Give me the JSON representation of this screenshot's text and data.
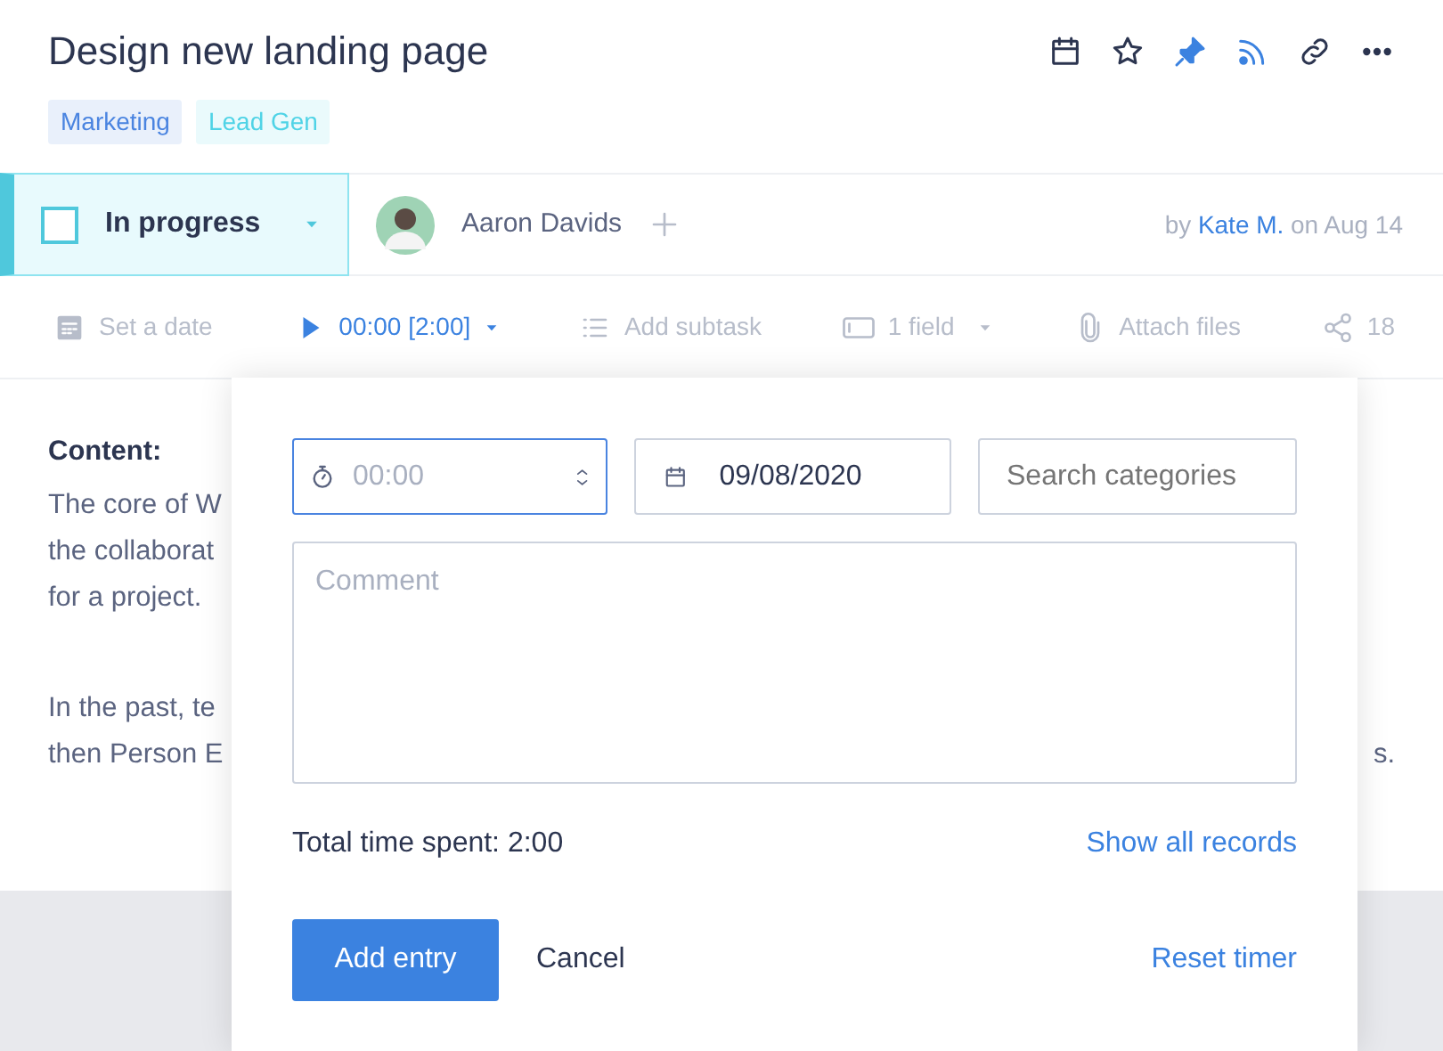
{
  "title": "Design new landing page",
  "toolbar_icons": [
    {
      "kind": "calendar",
      "active": false
    },
    {
      "kind": "star",
      "active": false
    },
    {
      "kind": "pin",
      "active": true
    },
    {
      "kind": "feed",
      "active": true
    },
    {
      "kind": "link",
      "active": false
    },
    {
      "kind": "more",
      "active": false
    }
  ],
  "tags": [
    {
      "label": "Marketing",
      "color": "#4a84e0"
    },
    {
      "label": "Lead Gen",
      "color": "#4fd3e6"
    }
  ],
  "status": {
    "label": "In progress",
    "checked": false
  },
  "assignee": {
    "name": "Aaron Davids"
  },
  "created": {
    "prefix": "by",
    "author": "Kate M.",
    "suffix": "on Aug 14"
  },
  "actions": [
    {
      "kind": "date",
      "label": "Set a date",
      "active": false
    },
    {
      "kind": "timer",
      "label": "00:00 [2:00]",
      "active": true
    },
    {
      "kind": "subtask",
      "label": "Add subtask",
      "active": false
    },
    {
      "kind": "field",
      "label": "1 field",
      "active": false
    },
    {
      "kind": "attach",
      "label": "Attach files",
      "active": false
    },
    {
      "kind": "share",
      "label": "18",
      "active": false
    }
  ],
  "content": {
    "heading": "Content:",
    "paragraphs": [
      [
        "The core of W",
        "the collaborat",
        "for a project."
      ],
      [
        "In the past, te",
        "then Person E"
      ]
    ],
    "line_end": "s."
  },
  "timer_form": {
    "duration": {
      "placeholder": "00:00",
      "focused": true
    },
    "date": {
      "value": "09/08/2020"
    },
    "category": {
      "placeholder": "Search categories"
    },
    "comment": {
      "placeholder": "Comment"
    },
    "total": "Total time spent: 2:00",
    "show_all": "Show all records",
    "add": "Add entry",
    "cancel": "Cancel",
    "reset": "Reset timer"
  }
}
